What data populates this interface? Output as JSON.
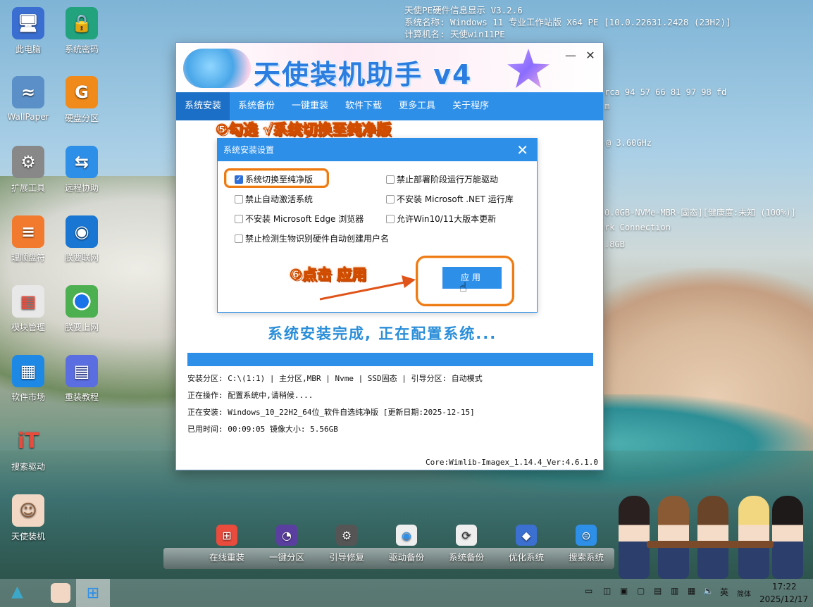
{
  "sysinfo": {
    "lines": [
      "天使PE硬件信息显示 V3.2.6",
      "系统名称: Windows 11 专业工作站版 X64 PE [10.0.22631.2428 (23H2)]",
      "计算机名: 天使win11PE"
    ],
    "frag1": "rca 94 57 66 81 97 98 fd",
    "frag2": "m",
    "frag3": "@ 3.60GHz",
    "frag4": "0.0GB-NVMe-MBR-固态][健康度:未知 (100%)]",
    "frag5": "rk Connection",
    "frag6": ".8GB"
  },
  "desktop_icons": [
    {
      "label": "此电脑",
      "icon": "monitor-icon",
      "color": "#3a6fd1"
    },
    {
      "label": "系统密码",
      "icon": "lock-icon",
      "color": "#22a27d"
    },
    {
      "label": "WallPaper",
      "icon": "wave-icon",
      "color": "#5a8fc8"
    },
    {
      "label": "硬盘分区",
      "icon": "partition-icon",
      "color": "#f08a1a"
    },
    {
      "label": "扩展工具",
      "icon": "gear-icon",
      "color": "#888888"
    },
    {
      "label": "远程协助",
      "icon": "remote-icon",
      "color": "#2e8fe8"
    },
    {
      "label": "理顺盘符",
      "icon": "drive-letter-icon",
      "color": "#f27a2e"
    },
    {
      "label": "朕要联网",
      "icon": "wifi-icon",
      "color": "#1976d2"
    },
    {
      "label": "模块管理",
      "icon": "store-icon",
      "color": "#e8e8e8"
    },
    {
      "label": "朕要上网",
      "icon": "chrome-icon",
      "color": "#4caf50"
    },
    {
      "label": "软件市场",
      "icon": "market-icon",
      "color": "#1e88e5"
    },
    {
      "label": "重装教程",
      "icon": "book-icon",
      "color": "#5b6ee1"
    },
    {
      "label": "搜索驱动",
      "icon": "driver-search-icon",
      "color": "#333333"
    },
    {
      "label": "天使装机",
      "icon": "angel-icon",
      "color": "#c98a6a"
    }
  ],
  "window": {
    "title": "天使装机助手 v4",
    "minimize": "—",
    "close": "✕",
    "tabs": [
      "系统安装",
      "系统备份",
      "一键重装",
      "软件下载",
      "更多工具",
      "关于程序"
    ],
    "callout_5": "⑤勾选 √系统切换至纯净版",
    "callout_6": "⑥点击 应用",
    "dialog": {
      "title": "系统安装设置",
      "close": "✕",
      "options": [
        {
          "label": "系统切换至纯净版",
          "checked": true
        },
        {
          "label": "禁止部署阶段运行万能驱动",
          "checked": false
        },
        {
          "label": "禁止自动激活系统",
          "checked": false
        },
        {
          "label": "不安装 Microsoft .NET 运行库",
          "checked": false
        },
        {
          "label": "不安装 Microsoft Edge 浏览器",
          "checked": false
        },
        {
          "label": "允许Win10/11大版本更新",
          "checked": false
        },
        {
          "label": "禁止检测生物识别硬件自动创建用户名",
          "checked": false
        }
      ],
      "apply": "应用"
    },
    "status": "系统安装完成, 正在配置系统...",
    "progress": 1.0,
    "info": {
      "partition": "安装分区: C:\\(1:1) | 主分区,MBR | Nvme | SSD固态 | 引导分区: 自动模式",
      "operation": "正在操作: 配置系统中,请稍候....",
      "installing": "正在安装: Windows_10_22H2_64位_软件自选纯净版 [更新日期:2025-12-15]",
      "elapsed": "已用时间: 00:09:05  镜像大小: 5.56GB"
    },
    "core_version": "Core:Wimlib-Imagex_1.14.4_Ver:4.6.1.0"
  },
  "dock": [
    {
      "label": "在线重装",
      "icon": "windows-icon",
      "color": "#e94b3c"
    },
    {
      "label": "一键分区",
      "icon": "pie-icon",
      "color": "#5b3fa0"
    },
    {
      "label": "引导修复",
      "icon": "repair-gear-icon",
      "color": "#555555"
    },
    {
      "label": "驱动备份",
      "icon": "wifi-icon",
      "color": "#eeeeee"
    },
    {
      "label": "系统备份",
      "icon": "sync-icon",
      "color": "#eeeeee"
    },
    {
      "label": "优化系统",
      "icon": "optimize-icon",
      "color": "#3b6fd0"
    },
    {
      "label": "搜索系统",
      "icon": "search-system-icon",
      "color": "#2e8fe8"
    }
  ],
  "tray": {
    "lang": "英",
    "ime": "简体",
    "time": "17:22",
    "date": "2025/12/17"
  }
}
